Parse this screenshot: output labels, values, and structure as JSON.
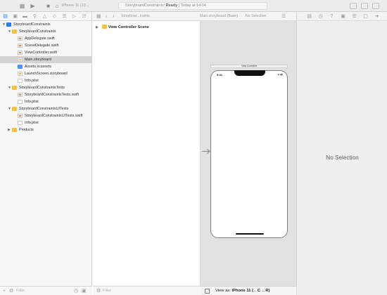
{
  "toolbar": {
    "scheme": "iPhone 11 (13...",
    "activity_project": "StoryboardConstraints:",
    "activity_status": "Ready",
    "activity_time": "| Today at 14:04"
  },
  "navigator": {
    "items": [
      {
        "label": "StoryboardConstraints",
        "indent": 0,
        "type": "project",
        "disclosure": "open"
      },
      {
        "label": "StoryboardConstraints",
        "indent": 1,
        "type": "folder",
        "disclosure": "open"
      },
      {
        "label": "AppDelegate.swift",
        "indent": 2,
        "type": "swift"
      },
      {
        "label": "SceneDelegate.swift",
        "indent": 2,
        "type": "swift"
      },
      {
        "label": "ViewController.swift",
        "indent": 2,
        "type": "swift"
      },
      {
        "label": "Main.storyboard",
        "indent": 2,
        "type": "storyboard",
        "selected": true
      },
      {
        "label": "Assets.xcassets",
        "indent": 2,
        "type": "assets"
      },
      {
        "label": "LaunchScreen.storyboard",
        "indent": 2,
        "type": "storyboard"
      },
      {
        "label": "Info.plist",
        "indent": 2,
        "type": "plist"
      },
      {
        "label": "StoryboardConstraintsTests",
        "indent": 1,
        "type": "folder",
        "disclosure": "open"
      },
      {
        "label": "StoryboardConstraintsTests.swift",
        "indent": 2,
        "type": "swift"
      },
      {
        "label": "Info.plist",
        "indent": 2,
        "type": "plist"
      },
      {
        "label": "StoryboardConstraintsUITests",
        "indent": 1,
        "type": "folder",
        "disclosure": "open"
      },
      {
        "label": "StoryboardConstraintsUITests.swift",
        "indent": 2,
        "type": "swift"
      },
      {
        "label": "Info.plist",
        "indent": 2,
        "type": "plist"
      },
      {
        "label": "Products",
        "indent": 1,
        "type": "folder",
        "disclosure": "closed"
      }
    ],
    "filter_placeholder": "Filter"
  },
  "jumpbar": {
    "crumbs": [
      "Storyboar...traints",
      "Main.storyboard (Base)",
      "No Selection"
    ]
  },
  "outline": {
    "scene": "View Controller Scene",
    "filter_placeholder": "Filter"
  },
  "canvas": {
    "vc_title": "View Controller",
    "status_time": "9:41",
    "view_as_prefix": "View as:",
    "view_as_device": "iPhone 11 (←C ←R)"
  },
  "inspector": {
    "no_selection": "No Selection"
  },
  "colors": {
    "accent": "#2f7cf6",
    "folder": "#f3c23c",
    "project": "#2a7ef0",
    "selection": "#d4d4d4",
    "canvas_bg": "#e1e1e1"
  }
}
